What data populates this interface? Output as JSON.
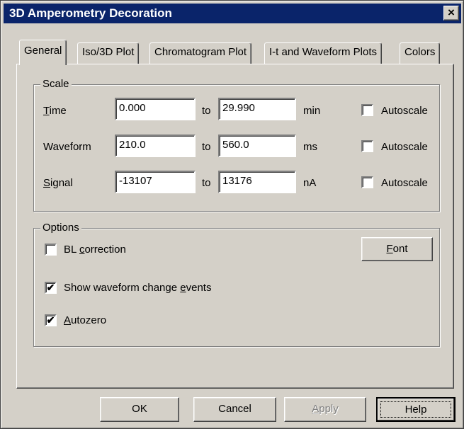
{
  "window": {
    "title": "3D Amperometry Decoration",
    "close_glyph": "×"
  },
  "tabs": [
    {
      "label": "General",
      "active": true
    },
    {
      "label": "Iso/3D Plot",
      "active": false
    },
    {
      "label": "Chromatogram Plot",
      "active": false
    },
    {
      "label": "I-t and Waveform Plots",
      "active": false
    },
    {
      "label": "Colors",
      "active": false
    }
  ],
  "scale": {
    "group_label": "Scale",
    "to_label": "to",
    "autoscale_label": "Autoscale",
    "rows": [
      {
        "label_mnemonic": "T",
        "label_rest": "ime",
        "from": "0.000",
        "to": "29.990",
        "unit": "min",
        "autoscale": false
      },
      {
        "label_mnemonic": "",
        "label_rest": "Waveform",
        "from": "210.0",
        "to": "560.0",
        "unit": "ms",
        "autoscale": false
      },
      {
        "label_mnemonic": "S",
        "label_rest": "ignal",
        "from": "-13107",
        "to": "13176",
        "unit": "nA",
        "autoscale": false
      }
    ]
  },
  "options": {
    "group_label": "Options",
    "bl_correction": {
      "pre": "BL ",
      "mnemonic": "c",
      "post": "orrection",
      "checked": false
    },
    "show_waveform": {
      "pre": "Show waveform change ",
      "mnemonic": "e",
      "post": "vents",
      "checked": true
    },
    "autozero": {
      "pre": "",
      "mnemonic": "A",
      "post": "utozero",
      "checked": true
    },
    "font_button": {
      "mnemonic": "F",
      "rest": "ont"
    }
  },
  "buttons": {
    "ok": "OK",
    "cancel": "Cancel",
    "apply_mnemonic": "A",
    "apply_rest": "pply",
    "help": "Help"
  },
  "glyphs": {
    "check": "✔"
  }
}
